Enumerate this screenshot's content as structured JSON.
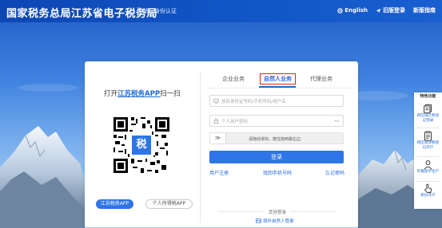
{
  "header": {
    "title": "国家税务总局江苏省电子税务局",
    "subtitle": "统一身份认证",
    "links": [
      {
        "icon": "globe-icon",
        "label": "English"
      },
      {
        "icon": "send-icon",
        "label": "旧版登录"
      },
      {
        "icon": "",
        "label": "新版指南"
      }
    ]
  },
  "login": {
    "scan_prefix": "打开",
    "scan_app": "江苏税务APP",
    "scan_suffix": "扫一扫",
    "qr_center_char": "税",
    "app_buttons": [
      "江苏税务APP",
      "个人所得税APP"
    ],
    "tabs": [
      "企业业务",
      "自然人业务",
      "代理业务"
    ],
    "active_tab": "自然人业务",
    "username_placeholder": "居民身份证号码/手机号码/用户名",
    "password_placeholder": "个人用户密码",
    "slider_handle": "≫",
    "slider_text": "请拖动滑块，按住拖到最右边",
    "login_button": "登录",
    "links": [
      "用户注册",
      "找回手机号码",
      "忘记密码"
    ],
    "other_login_label": "其他登录",
    "foreign_login": "境外自然人登录"
  },
  "sidebar": {
    "title": "特色功能",
    "items": [
      {
        "icon": "document-icon",
        "label": "跨区域迁移登记登录"
      },
      {
        "icon": "clipboard-icon",
        "label": "跨区域涉税登记开户"
      },
      {
        "icon": "user-icon",
        "label": "外籍留学生户"
      },
      {
        "icon": "hand-pointer-icon",
        "label": "新办开户"
      }
    ]
  },
  "colors": {
    "brand_blue": "#1257c8",
    "accent_blue": "#2d75e8",
    "highlight_red": "#e2231a"
  }
}
